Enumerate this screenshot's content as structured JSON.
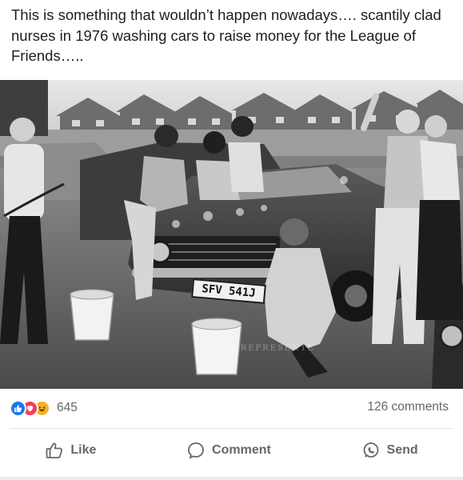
{
  "post": {
    "text": "This is something that wouldn’t happen nowadays…. scantily clad nurses in 1976 washing cars to raise money for the League of Friends….."
  },
  "photo": {
    "plate_text": "SFV 541J",
    "watermark": "PIN REPRESENTE"
  },
  "reactions": {
    "icons": [
      "like-icon",
      "love-icon",
      "haha-icon"
    ],
    "count": "645"
  },
  "comments": {
    "count_label": "126 comments"
  },
  "actions": {
    "like_label": "Like",
    "comment_label": "Comment",
    "send_label": "Send"
  },
  "colors": {
    "like_blue": "#1877f2",
    "love_red": "#f33e58",
    "haha_yellow": "#f7b125",
    "secondary_text": "#65676b"
  }
}
